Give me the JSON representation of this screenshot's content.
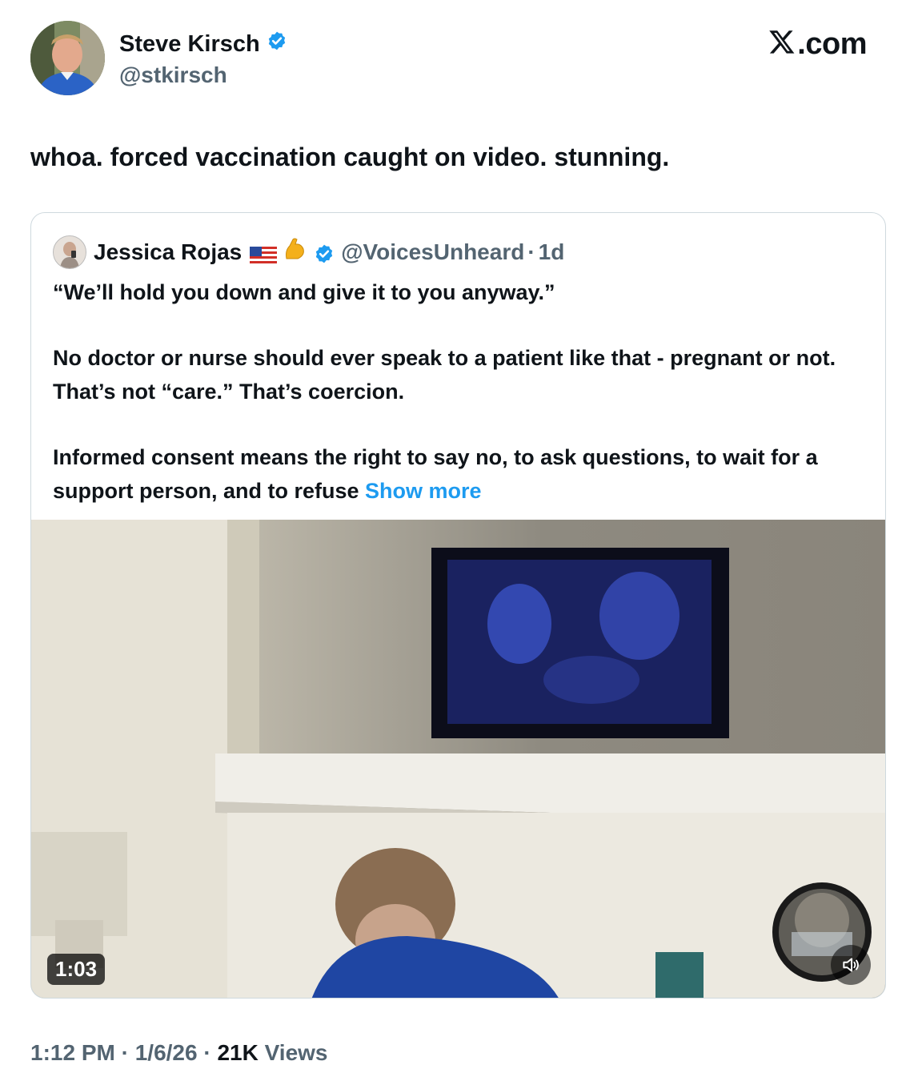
{
  "author": {
    "name": "Steve Kirsch",
    "handle": "@stkirsch",
    "verified_color": "#1d9bf0"
  },
  "brand": {
    "label": ".com"
  },
  "tweet": {
    "text": "whoa. forced vaccination caught on video. stunning."
  },
  "quoted_tweet": {
    "name": "Jessica Rojas",
    "handle": "@VoicesUnheard",
    "separator": "·",
    "age": "1d",
    "paragraphs": [
      "“We’ll hold you down and give it to you anyway.”",
      "No doctor or nurse should ever speak to a patient like that - pregnant or not. That’s not “care.” That’s coercion."
    ],
    "last_paragraph": "Informed consent means the right to say no, to ask questions, to wait for a support person, and to refuse ",
    "show_more": "Show more",
    "video": {
      "duration": "1:03"
    }
  },
  "footer": {
    "time": "1:12 PM",
    "sep1": " · ",
    "date": "1/6/26",
    "sep2": " · ",
    "views_count": "21K",
    "views_label": " Views"
  },
  "colors": {
    "link": "#1d9bf0",
    "secondary_text": "#536471",
    "border": "#cfd9de"
  }
}
